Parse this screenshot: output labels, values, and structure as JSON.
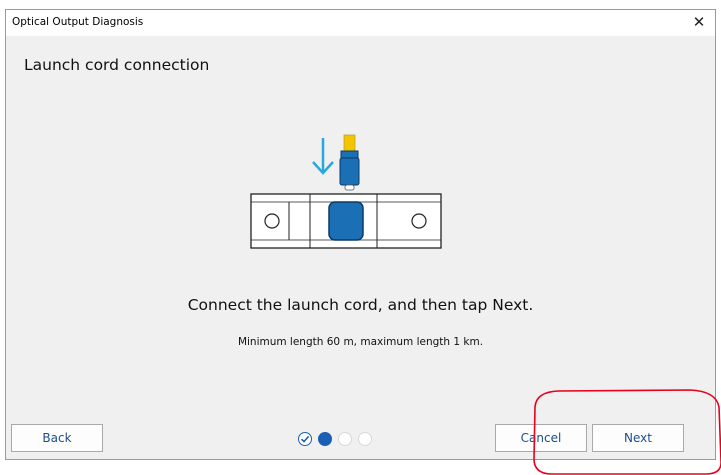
{
  "window": {
    "title": "Optical Output Diagnosis",
    "close_icon": "close-icon"
  },
  "page": {
    "title": "Launch cord connection",
    "instruction": "Connect the launch cord, and then tap Next.",
    "subtext": "Minimum length 60 m, maximum length 1 km."
  },
  "illustration": {
    "arrow_icon": "down-arrow-icon",
    "arrow_color": "#29a8e0",
    "connector_color": "#f2c500",
    "port_color": "#1a6fb5"
  },
  "footer": {
    "back_label": "Back",
    "cancel_label": "Cancel",
    "next_label": "Next",
    "steps": [
      {
        "state": "done"
      },
      {
        "state": "current"
      },
      {
        "state": "todo"
      },
      {
        "state": "todo"
      }
    ]
  },
  "colors": {
    "accent": "#1a5fb4",
    "highlight": "#e8001c"
  }
}
